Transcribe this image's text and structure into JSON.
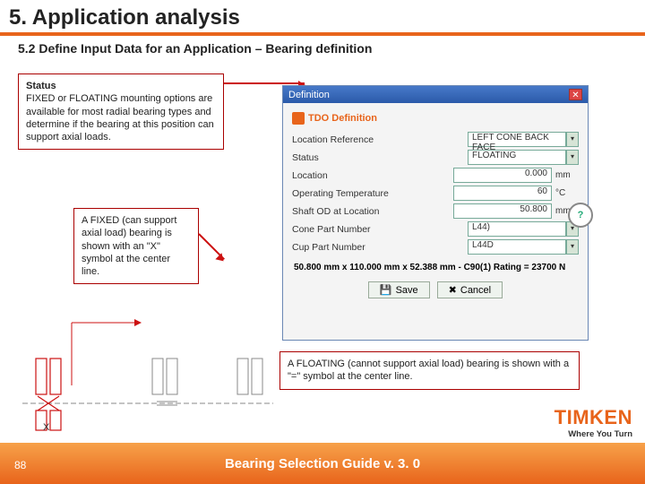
{
  "header": {
    "title": "5. Application analysis"
  },
  "subhead": "5.2 Define Input Data for an Application – Bearing definition",
  "callouts": {
    "c1_title": "Status",
    "c1_body": "FIXED or FLOATING mounting options are available for most radial bearing types and determine if the bearing at this position can support axial loads.",
    "c2_body": "A FIXED (can support axial load) bearing is shown with an \"X\" symbol at the center line.",
    "c3_body": "A FLOATING (cannot support axial load) bearing is shown with a \"=\" symbol at the center line."
  },
  "dialog": {
    "title": "Definition",
    "heading": "TDO Definition",
    "rows": {
      "locref_lbl": "Location Reference",
      "locref_val": "LEFT CONE BACK FACE",
      "status_lbl": "Status",
      "status_val": "FLOATING",
      "loc_lbl": "Location",
      "loc_val": "0.000",
      "loc_unit": "mm",
      "temp_lbl": "Operating Temperature",
      "temp_val": "60",
      "temp_unit": "°C",
      "shaft_lbl": "Shaft OD at Location",
      "shaft_val": "50.800",
      "shaft_unit": "mm",
      "cone_lbl": "Cone Part Number",
      "cone_val": "L44)",
      "cup_lbl": "Cup Part Number",
      "cup_val": "L44D"
    },
    "summary": "50.800 mm x 110.000 mm x 52.388 mm - C90(1) Rating = 23700 N",
    "save": "Save",
    "cancel": "Cancel",
    "mag": "?"
  },
  "brand": {
    "logo": "TIMKEN",
    "tag": "Where You Turn"
  },
  "footer": {
    "title": "Bearing Selection Guide v. 3. 0",
    "page": "88"
  }
}
